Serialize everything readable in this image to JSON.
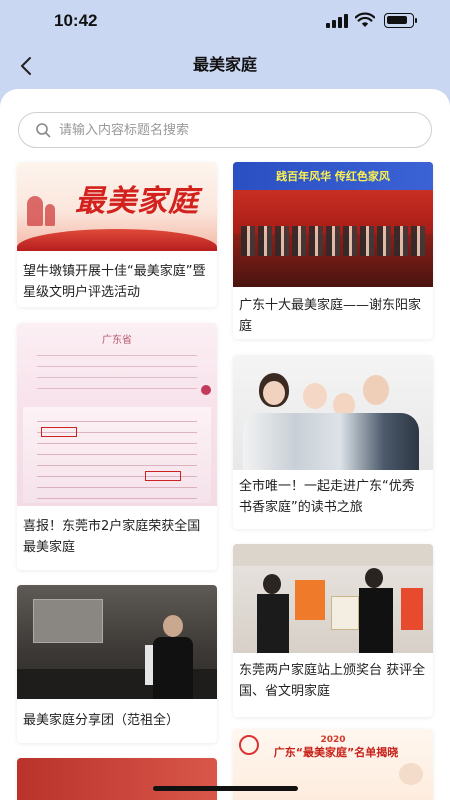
{
  "status_bar": {
    "time": "10:42",
    "battery_level": 0.85
  },
  "nav": {
    "title": "最美家庭",
    "back_icon": "chevron-left-icon"
  },
  "search": {
    "placeholder": "请输入内容标题名搜索",
    "value": ""
  },
  "cards": [
    {
      "title": "望牛墩镇开展十佳“最美家庭”暨星级文明户评选活动",
      "image_text": "最美家庭"
    },
    {
      "title": "广东十大最美家庭——谢东阳家庭",
      "image_text": "践百年风华 传红色家风"
    },
    {
      "title": "喜报！东莞市2户家庭荣获全国最美家庭",
      "image_text": "广东省"
    },
    {
      "title": "全市唯一！一起走进广东“优秀书香家庭”的读书之旅",
      "image_text": ""
    },
    {
      "title": "最美家庭分享团（范祖全）",
      "image_text": ""
    },
    {
      "title": "东莞两户家庭站上颁奖台 获评全国、省文明家庭",
      "image_text": ""
    },
    {
      "title": "",
      "image_text": ""
    },
    {
      "title": "",
      "image_text": "广东“最美家庭”名单揭晓",
      "image_year": "2020"
    }
  ]
}
